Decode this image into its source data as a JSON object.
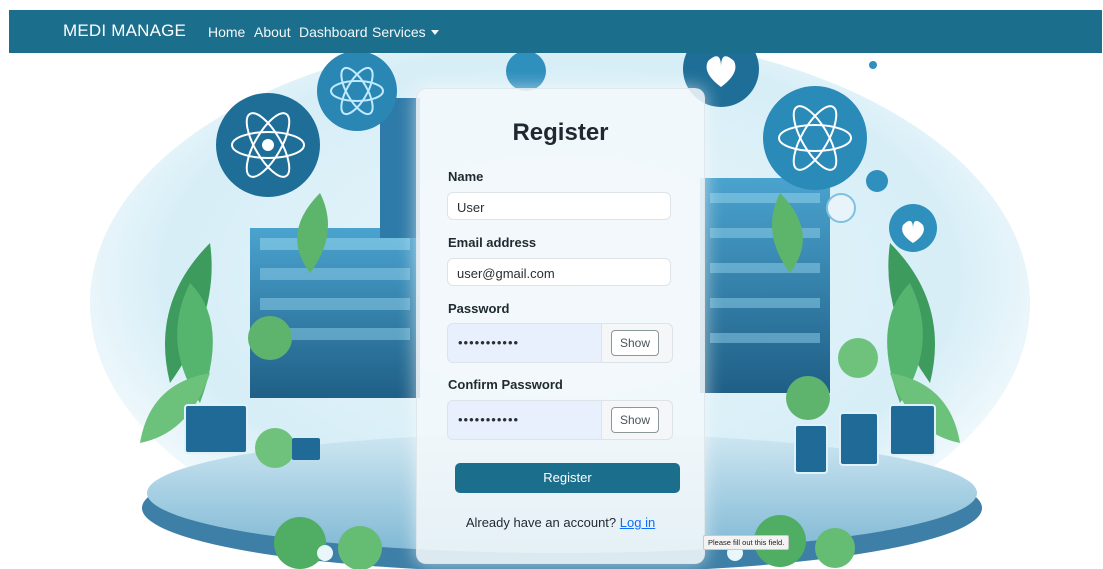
{
  "navbar": {
    "brand": "MEDI MANAGE",
    "links": [
      "Home",
      "About",
      "Dashboard",
      "Services"
    ]
  },
  "form": {
    "title": "Register",
    "name_label": "Name",
    "name_value": "User",
    "email_label": "Email address",
    "email_value": "user@gmail.com",
    "password_label": "Password",
    "password_mask": "•••••••••••",
    "show_label": "Show",
    "confirm_label": "Confirm Password",
    "confirm_mask": "•••••••••••",
    "submit_label": "Register",
    "login_prompt": "Already have an account?",
    "login_link": "Log in"
  },
  "tooltip": "Please fill out this field.",
  "colors": {
    "primary": "#1b6f8c",
    "link": "#0d6efd",
    "autofill": "#e8f0fe"
  }
}
